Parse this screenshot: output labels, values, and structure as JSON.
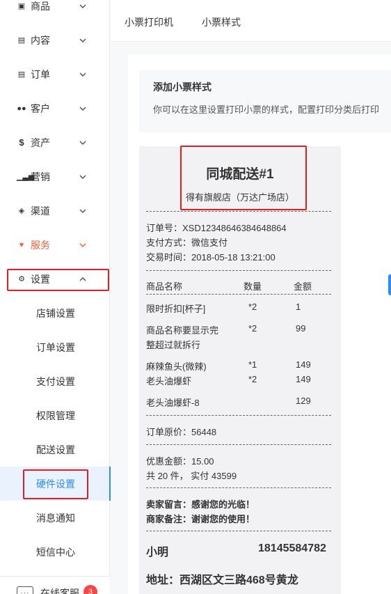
{
  "sidebar": {
    "items": [
      {
        "label": "商品",
        "icon": "box-icon"
      },
      {
        "label": "内容",
        "icon": "document-icon"
      },
      {
        "label": "订单",
        "icon": "list-icon"
      },
      {
        "label": "客户",
        "icon": "users-icon"
      },
      {
        "label": "资产",
        "icon": "dollar-icon"
      },
      {
        "label": "营销",
        "icon": "bar-chart-icon"
      },
      {
        "label": "渠道",
        "icon": "layers-icon"
      },
      {
        "label": "服务",
        "icon": "heart-icon"
      },
      {
        "label": "设置",
        "icon": "gear-icon"
      }
    ],
    "sub_items": [
      "店铺设置",
      "订单设置",
      "支付设置",
      "权限管理",
      "配送设置",
      "硬件设置",
      "消息通知",
      "短信中心"
    ],
    "support_label": "在线客服",
    "support_badge": "3"
  },
  "tabs": [
    "小票打印机",
    "小票样式"
  ],
  "info": {
    "title": "添加小票样式",
    "desc": "你可以在这里设置打印小票的样式，配置打印分类后打印"
  },
  "receipt": {
    "title": "同城配送#1",
    "store": "得有旗舰店（万达广场店）",
    "order_no": "订单号：XSD12348646384648864",
    "pay_method": "支付方式：微信支付",
    "trade_time": "交易时间：2018-05-18   13:21:00",
    "headers": [
      "商品名称",
      "数量",
      "金额"
    ],
    "items": [
      {
        "name": "限时折扣[杯子]",
        "qty": "*2",
        "amount": "1"
      },
      {
        "name": "商品名称要显示完",
        "qty": "*2",
        "amount": "99"
      },
      {
        "name": "整超过就拆行",
        "qty": "",
        "amount": ""
      },
      {
        "name": "麻辣鱼头(微辣)",
        "qty": "*1",
        "amount": "149"
      },
      {
        "name": "老头油爆虾",
        "qty": "*2",
        "amount": "149"
      },
      {
        "name": "老头油爆虾-8",
        "qty": "",
        "amount": "129"
      }
    ],
    "original_price": "订单原价：56448",
    "discount": "优惠金额：15.00",
    "summary": "共 20 件，  实付 43599",
    "buyer_note": "卖家留言：感谢您的光临！",
    "seller_note": "商家备注：谢谢您的使用！",
    "customer_name": "小明",
    "customer_phone": "18145584782",
    "address": "地址：西湖区文三路468号黄龙"
  },
  "colors": {
    "accent": "#2d8cf0",
    "highlight": "#f5603b",
    "annotation": "#e02020"
  }
}
